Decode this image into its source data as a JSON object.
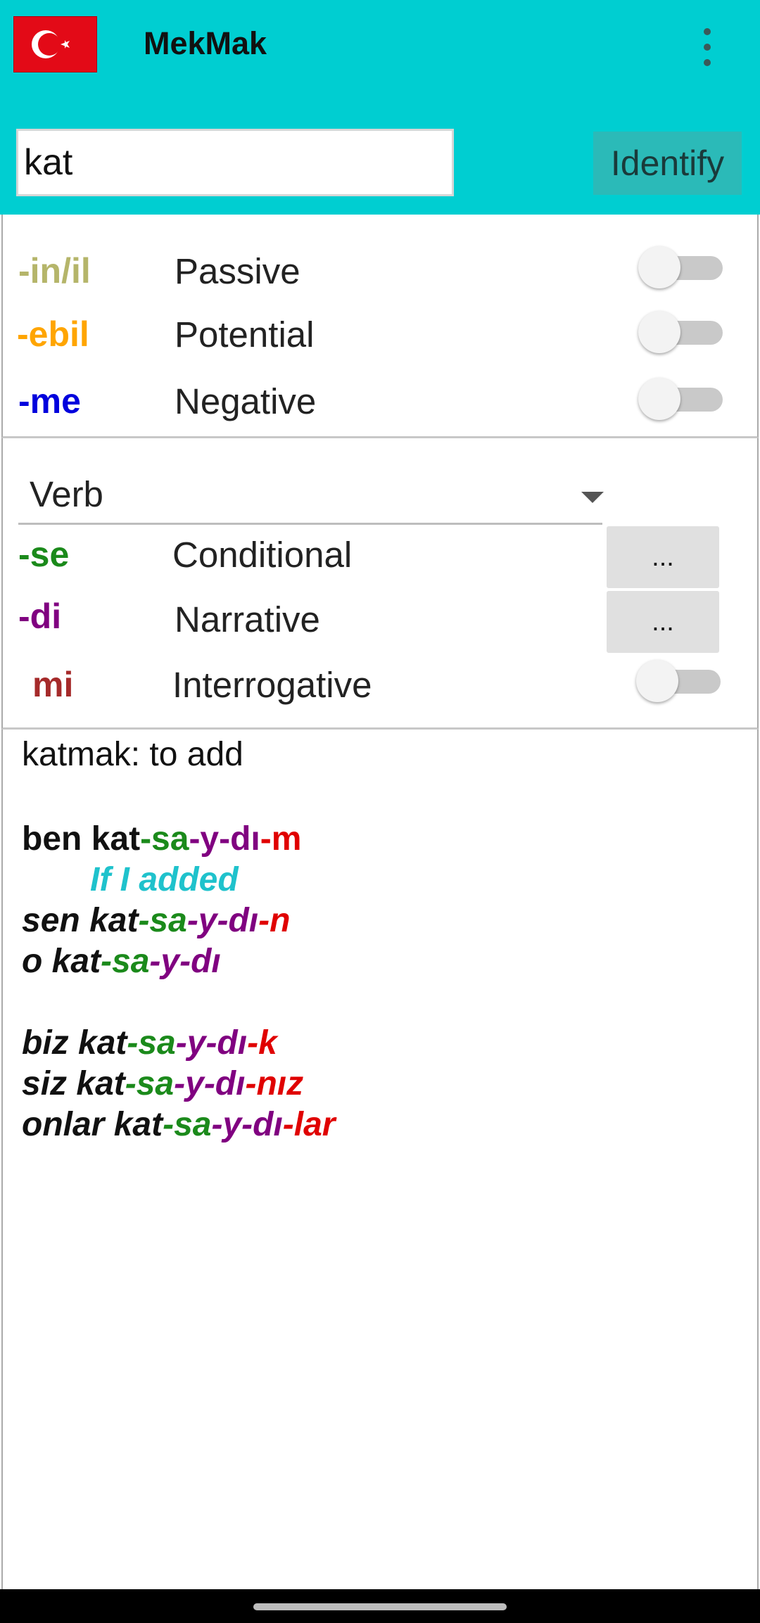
{
  "app": {
    "title": "MekMak",
    "flag_icon": "turkish-flag-icon",
    "menu_icon": "more-vert-icon"
  },
  "search": {
    "value": "kat",
    "placeholder": "",
    "identify_label": "Identify"
  },
  "voice_options": [
    {
      "suffix": "-in/il",
      "label": "Passive",
      "color": "#b5b56a",
      "on": false
    },
    {
      "suffix": "-ebil",
      "label": "Potential",
      "color": "#ffa500",
      "on": false
    },
    {
      "suffix": "-me",
      "label": "Negative",
      "color": "#0000dd",
      "on": false
    }
  ],
  "mood": {
    "dropdown_value": "Verb",
    "rows": [
      {
        "suffix": "-se",
        "label": "Conditional",
        "color": "#1b8a1b",
        "control": "..."
      },
      {
        "suffix": "-di",
        "label": "Narrative",
        "color": "#800080",
        "control": "..."
      },
      {
        "suffix": "mi",
        "label": "Interrogative",
        "color": "#a52a2a",
        "on": false
      }
    ]
  },
  "output": {
    "definition": "katmak: to add",
    "translation": "If I added",
    "conjugations": [
      {
        "pronoun": "ben",
        "stem": "kat",
        "parts": [
          "-sa",
          "-y",
          "-dı",
          "-m"
        ]
      },
      {
        "pronoun": "sen",
        "stem": "kat",
        "parts": [
          "-sa",
          "-y",
          "-dı",
          "-n"
        ]
      },
      {
        "pronoun": "o",
        "stem": "kat",
        "parts": [
          "-sa",
          "-y",
          "-dı",
          ""
        ]
      },
      {
        "pronoun": "biz",
        "stem": "kat",
        "parts": [
          "-sa",
          "-y",
          "-dı",
          "-k"
        ]
      },
      {
        "pronoun": "siz",
        "stem": "kat",
        "parts": [
          "-sa",
          "-y",
          "-dı",
          "-nız"
        ]
      },
      {
        "pronoun": "onlar",
        "stem": "kat",
        "parts": [
          "-sa",
          "-y",
          "-dı",
          "-lar"
        ]
      }
    ]
  },
  "colors": {
    "header": "#00ced1",
    "identify_bg": "#2bbab8",
    "translation": "#1fc2cc"
  }
}
